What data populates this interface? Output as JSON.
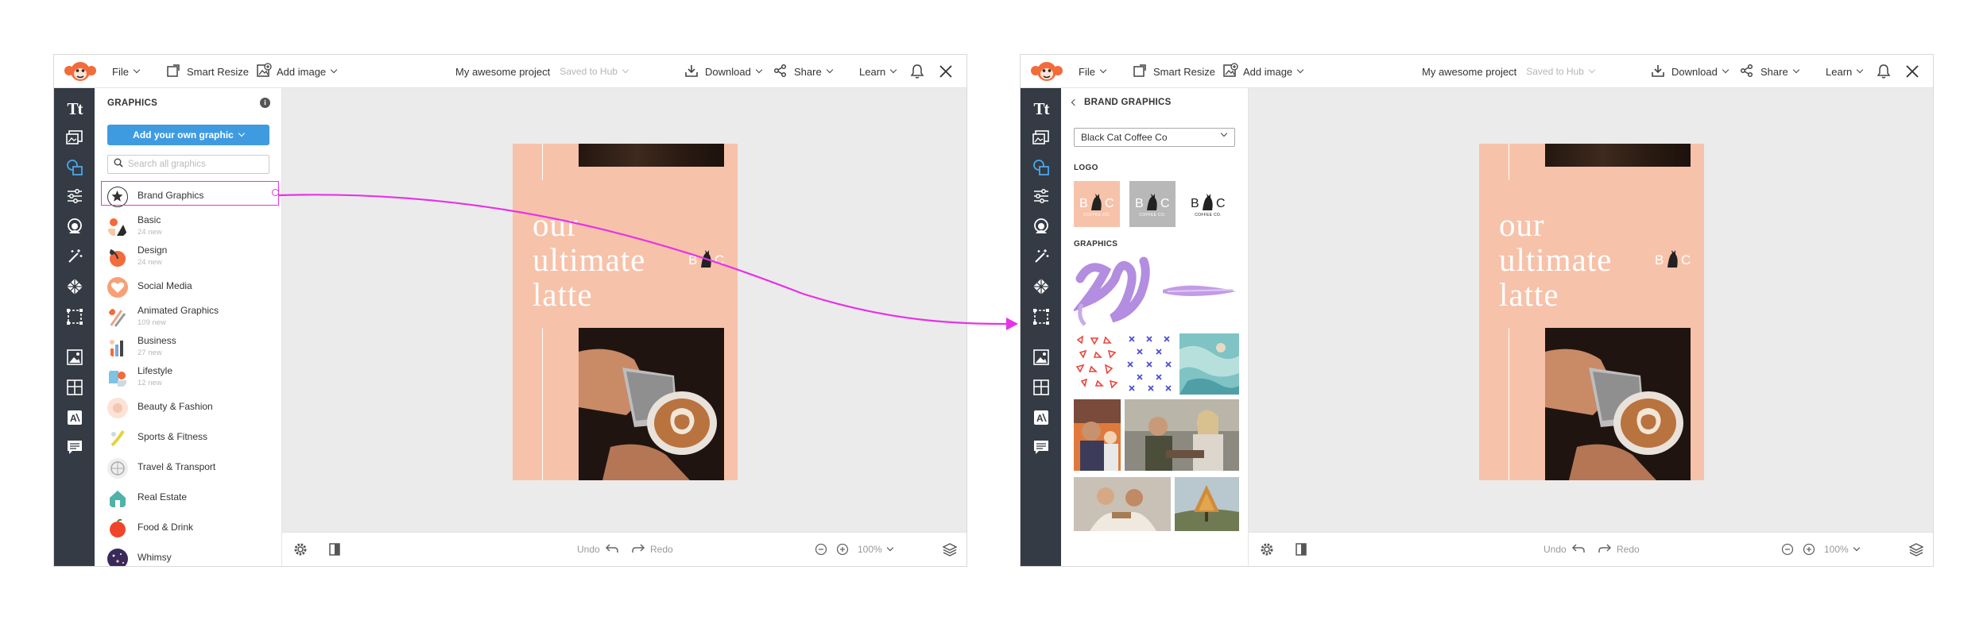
{
  "colors": {
    "accent_blue": "#3f9be0",
    "rail_dark": "#353b45",
    "poster_peach": "#f7c2aa",
    "annotation_magenta": "#e832e8",
    "logo_orange": "#f26b3a"
  },
  "topbar": {
    "file_label": "File",
    "smart_resize_label": "Smart Resize",
    "add_image_label": "Add image",
    "project_title": "My awesome project",
    "saved_status": "Saved to Hub",
    "download_label": "Download",
    "share_label": "Share",
    "learn_label": "Learn",
    "icons": [
      "monkey-logo-icon",
      "smart-resize-icon",
      "add-image-icon",
      "download-icon",
      "share-icon",
      "bell-icon",
      "close-icon"
    ]
  },
  "rail": {
    "icons": [
      "text-icon",
      "photos-icon",
      "graphics-icon",
      "adjust-icon",
      "touch-up-icon",
      "effects-icon",
      "textures-icon",
      "frames-icon",
      "image-edit-icon",
      "layout-icon",
      "text-style-icon",
      "comments-icon"
    ]
  },
  "left_panel": {
    "title": "GRAPHICS",
    "info_glyph": "i",
    "add_button": "Add your own graphic",
    "search_placeholder": "Search all graphics",
    "categories": [
      {
        "name": "Brand Graphics",
        "sub": ""
      },
      {
        "name": "Basic",
        "sub": "24 new"
      },
      {
        "name": "Design",
        "sub": "24 new"
      },
      {
        "name": "Social Media",
        "sub": ""
      },
      {
        "name": "Animated Graphics",
        "sub": "109 new"
      },
      {
        "name": "Business",
        "sub": "27 new"
      },
      {
        "name": "Lifestyle",
        "sub": "12 new"
      },
      {
        "name": "Beauty & Fashion",
        "sub": ""
      },
      {
        "name": "Sports & Fitness",
        "sub": ""
      },
      {
        "name": "Travel & Transport",
        "sub": ""
      },
      {
        "name": "Real Estate",
        "sub": ""
      },
      {
        "name": "Food & Drink",
        "sub": ""
      },
      {
        "name": "Whimsy",
        "sub": ""
      }
    ]
  },
  "right_panel": {
    "title": "BRAND GRAPHICS",
    "brand_selected": "Black Cat Coffee Co",
    "logo_section": "LOGO",
    "graphics_section": "GRAPHICS",
    "logo_tile_b": "B",
    "logo_tile_c": "C",
    "logo_tile_sub": "COFFEE CO."
  },
  "poster": {
    "headline_lines": [
      "our",
      "ultimate",
      "latte"
    ],
    "logo_b": "B",
    "logo_c": "C"
  },
  "bottombar": {
    "undo_label": "Undo",
    "redo_label": "Redo",
    "zoom_label": "100%"
  }
}
